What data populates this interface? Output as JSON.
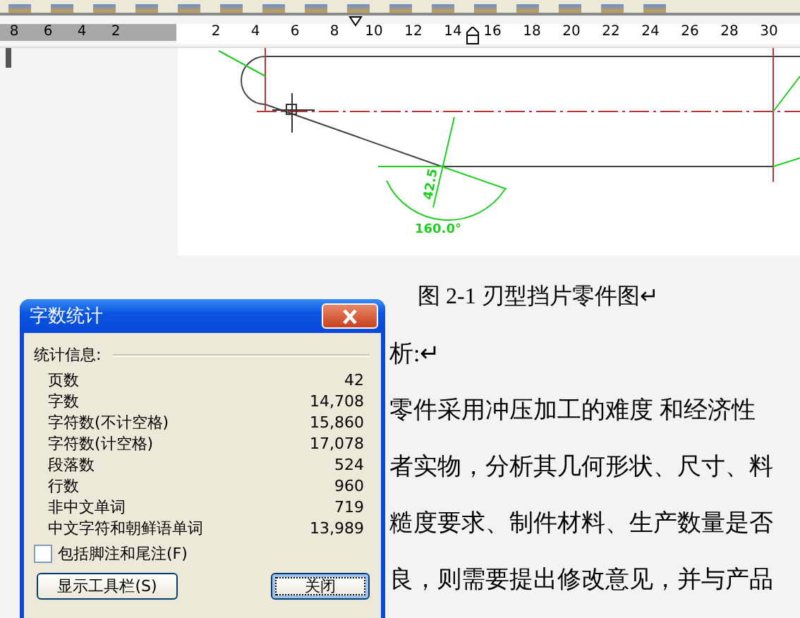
{
  "ruler": {
    "left_numbers": [
      "8",
      "6",
      "4",
      "2"
    ],
    "numbers": [
      "2",
      "4",
      "6",
      "8",
      "10",
      "12",
      "14",
      "16",
      "18",
      "20",
      "22",
      "24",
      "26",
      "28",
      "30"
    ]
  },
  "document": {
    "figure": {
      "labels": [
        "42.5",
        "160.0°"
      ]
    },
    "caption": "图 2-1  刃型挡片零件图↵",
    "lines": [
      "析:↵",
      "零件采用冲压加工的难度 和经济性",
      "者实物，分析其几何形状、尺寸、料",
      "糙度要求、制件材料、生产数量是否",
      "良，则需要提出修改意见，并与产品"
    ]
  },
  "dialog": {
    "title": "字数统计",
    "section": "统计信息:",
    "stats": [
      {
        "label": "页数",
        "value": "42"
      },
      {
        "label": "字数",
        "value": "14,708"
      },
      {
        "label": "字符数(不计空格)",
        "value": "15,860"
      },
      {
        "label": "字符数(计空格)",
        "value": "17,078"
      },
      {
        "label": "段落数",
        "value": "524"
      },
      {
        "label": "行数",
        "value": "960"
      },
      {
        "label": "非中文单词",
        "value": "719"
      },
      {
        "label": "中文字符和朝鲜语单词",
        "value": "13,989"
      }
    ],
    "checkbox": {
      "label": "包括脚注和尾注(F)",
      "checked": false
    },
    "buttons": [
      {
        "label": "显示工具栏(S)",
        "focused": false
      },
      {
        "label": "关闭",
        "focused": true
      }
    ]
  }
}
